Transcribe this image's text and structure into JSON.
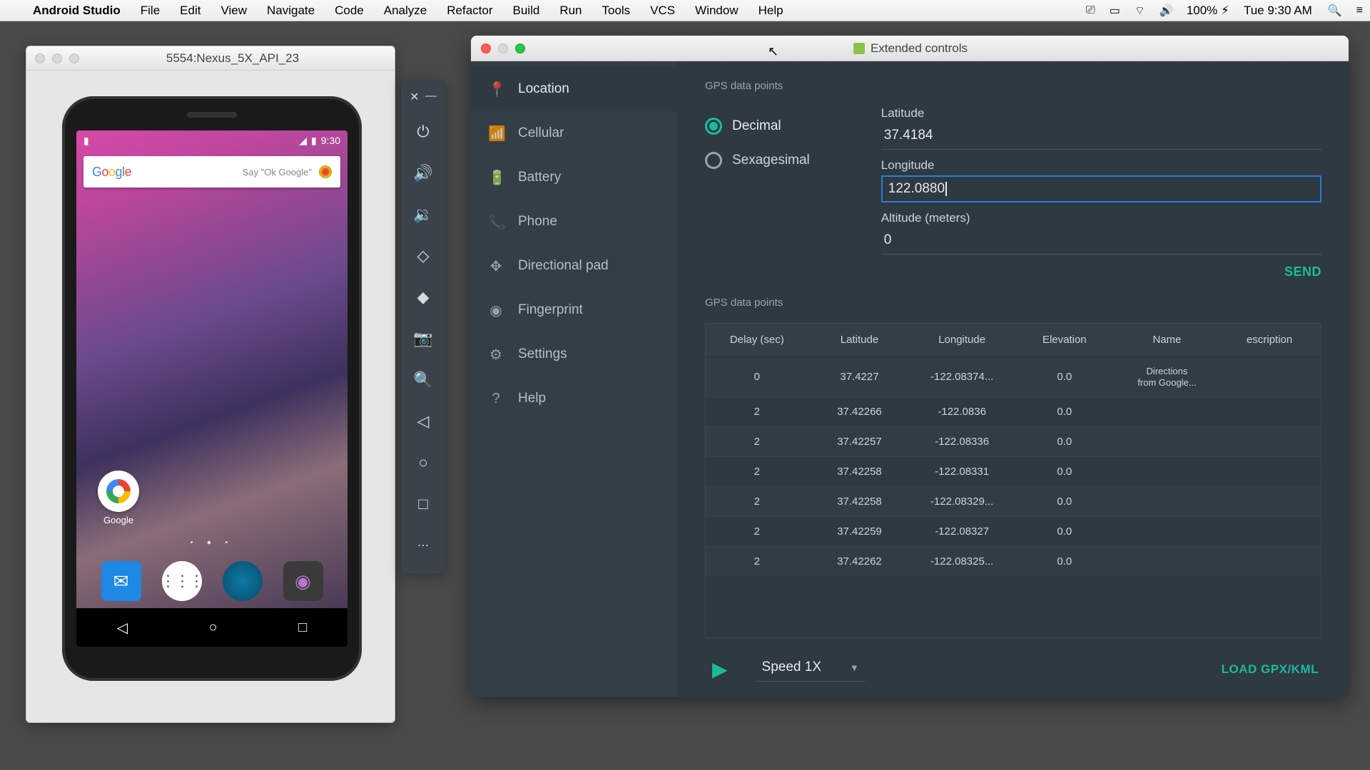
{
  "menubar": {
    "app": "Android Studio",
    "items": [
      "File",
      "Edit",
      "View",
      "Navigate",
      "Code",
      "Analyze",
      "Refactor",
      "Build",
      "Run",
      "Tools",
      "VCS",
      "Window",
      "Help"
    ],
    "battery": "100%",
    "clock": "Tue 9:30 AM"
  },
  "emulator": {
    "title": "5554:Nexus_5X_API_23",
    "status_time": "9:30",
    "search_hint": "Say \"Ok Google\"",
    "google_label": "Google"
  },
  "ext": {
    "title": "Extended controls",
    "nav": [
      {
        "icon": "📍",
        "label": "Location",
        "active": true
      },
      {
        "icon": "📶",
        "label": "Cellular"
      },
      {
        "icon": "🔋",
        "label": "Battery"
      },
      {
        "icon": "📞",
        "label": "Phone"
      },
      {
        "icon": "✥",
        "label": "Directional pad"
      },
      {
        "icon": "◉",
        "label": "Fingerprint"
      },
      {
        "icon": "⚙",
        "label": "Settings"
      },
      {
        "icon": "?",
        "label": "Help"
      }
    ],
    "gps": {
      "section1": "GPS data points",
      "radio_decimal": "Decimal",
      "radio_sexagesimal": "Sexagesimal",
      "lat_label": "Latitude",
      "lat_value": "37.4184",
      "lon_label": "Longitude",
      "lon_value": "122.0880",
      "alt_label": "Altitude (meters)",
      "alt_value": "0",
      "send": "SEND",
      "section2": "GPS data points",
      "columns": [
        "Delay (sec)",
        "Latitude",
        "Longitude",
        "Elevation",
        "Name",
        "escription"
      ],
      "rows": [
        {
          "delay": "0",
          "lat": "37.4227",
          "lon": "-122.08374...",
          "elev": "0.0",
          "name": "Directions from Google...",
          "desc": ""
        },
        {
          "delay": "2",
          "lat": "37.42266",
          "lon": "-122.0836",
          "elev": "0.0",
          "name": "",
          "desc": ""
        },
        {
          "delay": "2",
          "lat": "37.42257",
          "lon": "-122.08336",
          "elev": "0.0",
          "name": "",
          "desc": ""
        },
        {
          "delay": "2",
          "lat": "37.42258",
          "lon": "-122.08331",
          "elev": "0.0",
          "name": "",
          "desc": ""
        },
        {
          "delay": "2",
          "lat": "37.42258",
          "lon": "-122.08329...",
          "elev": "0.0",
          "name": "",
          "desc": ""
        },
        {
          "delay": "2",
          "lat": "37.42259",
          "lon": "-122.08327",
          "elev": "0.0",
          "name": "",
          "desc": ""
        },
        {
          "delay": "2",
          "lat": "37.42262",
          "lon": "-122.08325...",
          "elev": "0.0",
          "name": "",
          "desc": ""
        }
      ],
      "speed": "Speed 1X",
      "load": "LOAD GPX/KML"
    }
  },
  "side_icons": [
    "⏻",
    "🔊",
    "🔉",
    "◇",
    "◆",
    "📷",
    "�🔍",
    "◁",
    "○",
    "□",
    "⋯"
  ]
}
